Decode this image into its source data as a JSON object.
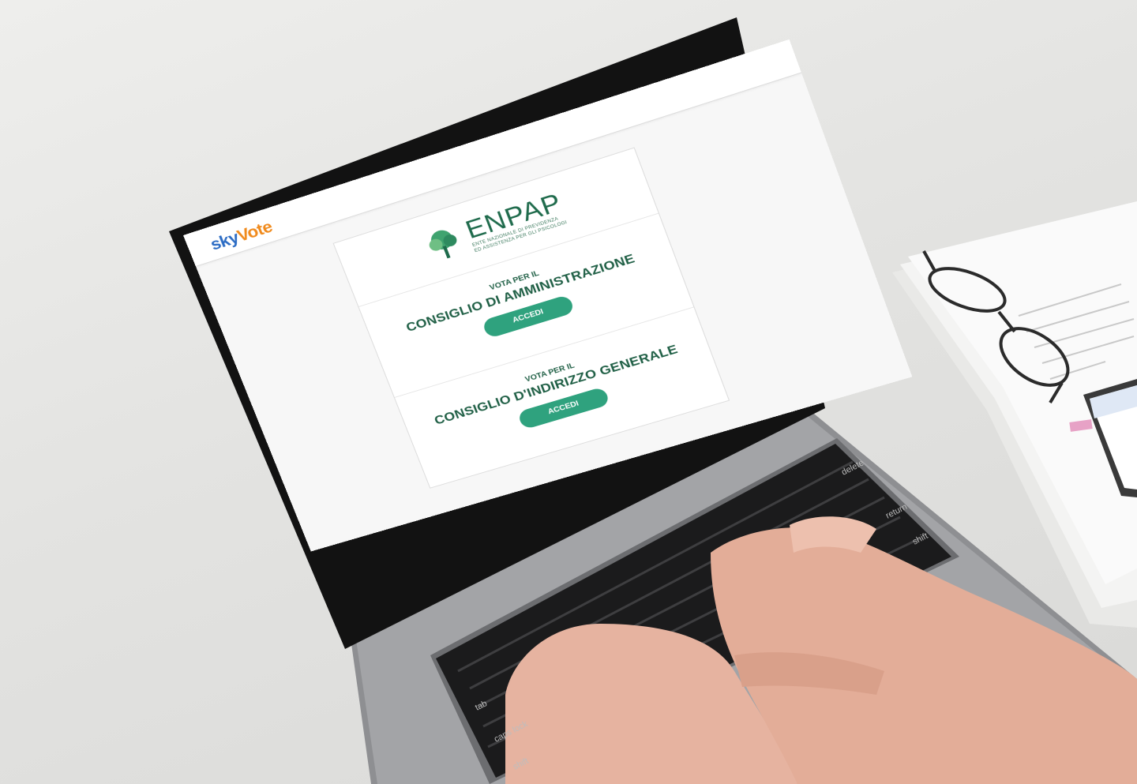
{
  "screen": {
    "brand": {
      "part1": "sky",
      "part2": "Vote"
    },
    "logo": {
      "name": "ENPAP",
      "subtitle_line1": "Ente Nazionale di Previdenza",
      "subtitle_line2": "ed Assistenza per gli Psicologi"
    },
    "sections": [
      {
        "kicker": "VOTA PER IL",
        "title": "CONSIGLIO DI AMMINISTRAZIONE",
        "button": "ACCEDI"
      },
      {
        "kicker": "VOTA PER IL",
        "title": "CONSIGLIO D'INDIRIZZO GENERALE",
        "button": "ACCEDI"
      }
    ]
  },
  "keyboard": {
    "keys": [
      "delete",
      "return",
      "shift",
      "tab",
      "caps lock",
      "shift"
    ]
  },
  "colors": {
    "accent": "#2fa27e",
    "heading": "#1f5f45",
    "brand_blue": "#2c6cc4",
    "brand_orange": "#f08a1c"
  }
}
